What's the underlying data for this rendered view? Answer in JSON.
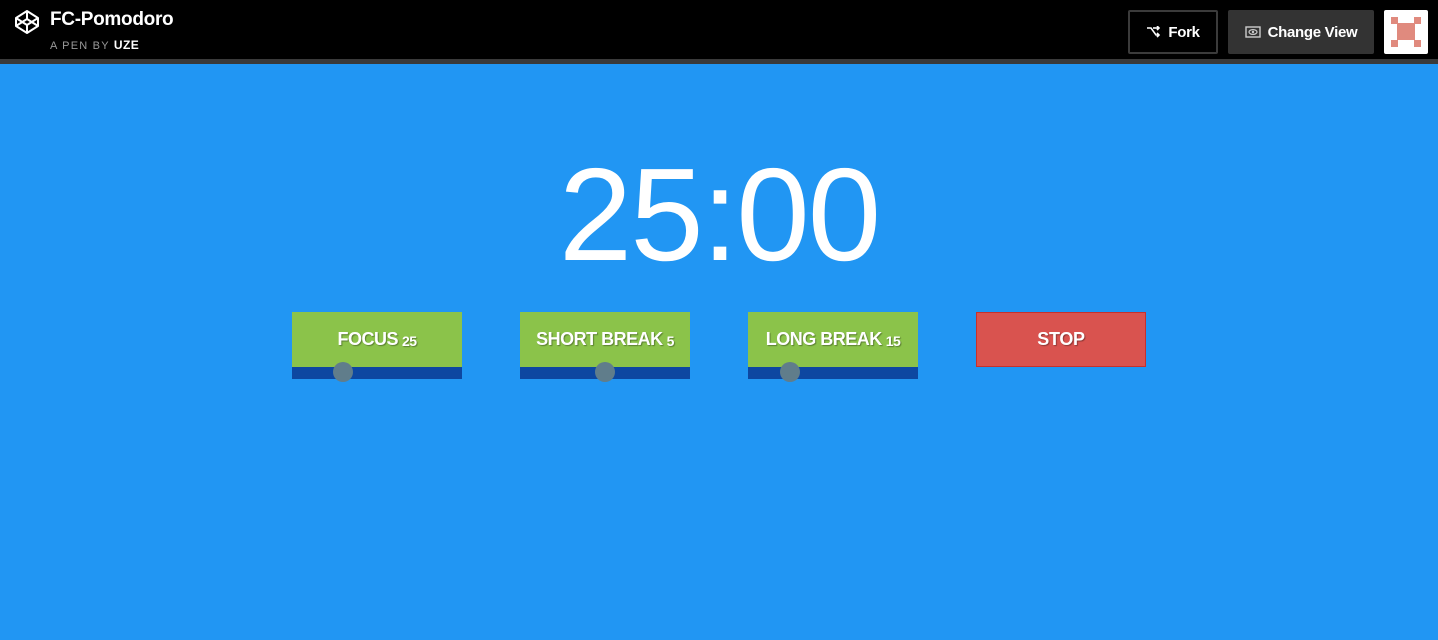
{
  "header": {
    "pen_title": "FC-Pomodoro",
    "by_prefix": "A PEN BY",
    "author": "UZE",
    "fork_label": "Fork",
    "change_view_label": "Change View",
    "logo_icon": "codepen-logo-icon",
    "fork_icon": "fork-icon",
    "view_icon": "eye-icon"
  },
  "timer": {
    "display": "25:00"
  },
  "controls": {
    "focus": {
      "label": "FOCUS",
      "value": "25"
    },
    "short_break": {
      "label": "SHORT BREAK",
      "value": "5"
    },
    "long_break": {
      "label": "LONG BREAK",
      "value": "15"
    },
    "stop": {
      "label": "STOP"
    }
  },
  "colors": {
    "background": "#2196f3",
    "control_green": "#8bc34a",
    "track_blue": "#0d47a1",
    "knob_gray": "#607d8b",
    "stop_red": "#d9534f"
  }
}
